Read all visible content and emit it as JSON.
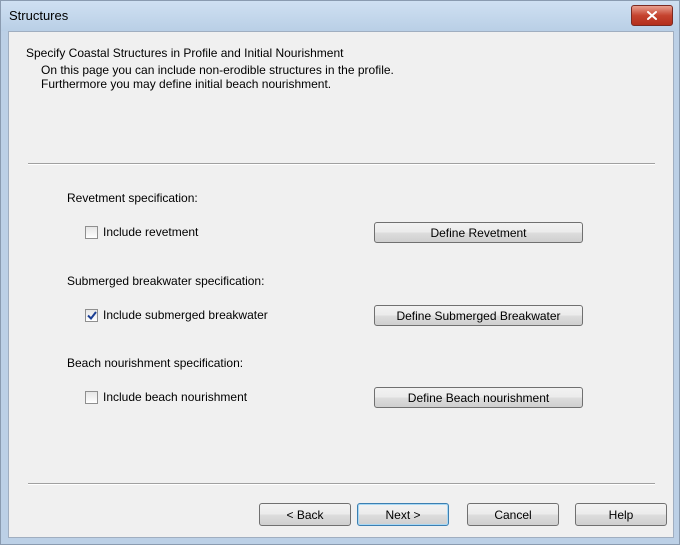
{
  "window": {
    "title": "Structures"
  },
  "header": {
    "title": "Specify Coastal Structures in Profile and Initial Nourishment",
    "desc_line1": "On this page you can include non-erodible structures in the profile.",
    "desc_line2": "Furthermore you may define initial beach nourishment."
  },
  "sections": {
    "revetment": {
      "label": "Revetment specification:",
      "checkbox_label": "Include revetment",
      "checked": false,
      "button_label": "Define Revetment"
    },
    "breakwater": {
      "label": "Submerged breakwater specification:",
      "checkbox_label": "Include submerged breakwater",
      "checked": true,
      "button_label": "Define Submerged Breakwater"
    },
    "nourishment": {
      "label": "Beach nourishment specification:",
      "checkbox_label": "Include beach nourishment",
      "checked": false,
      "button_label": "Define Beach nourishment"
    }
  },
  "footer": {
    "back_label": "< Back",
    "next_label": "Next >",
    "cancel_label": "Cancel",
    "help_label": "Help"
  },
  "colors": {
    "close_button": "#c5432f",
    "default_button_border": "#3c7fb1",
    "check_mark": "#1c3f94"
  },
  "icons": {
    "close": "close-icon",
    "check": "check-icon"
  }
}
